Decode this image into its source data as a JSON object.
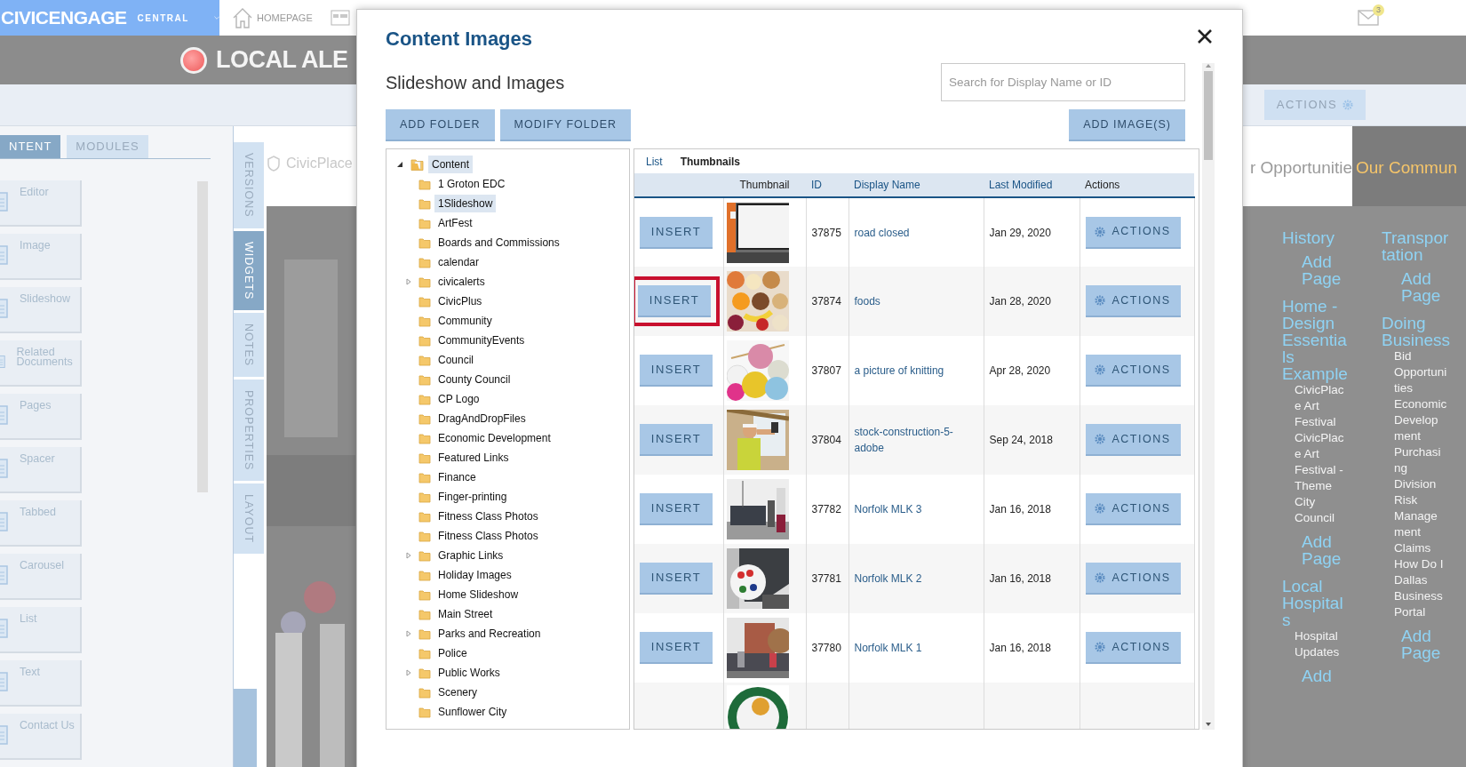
{
  "top_bar": {
    "brand": "CIVICENGAGE",
    "product": "CENTRAL",
    "home_link": "HOMEPAGE",
    "mail_count": "3"
  },
  "alert_banner": {
    "text": "LOCAL ALE"
  },
  "toolbar": {
    "actions_button": "ACTIONS"
  },
  "left_panel": {
    "tabs": [
      {
        "label": "NTENT",
        "selected": true
      },
      {
        "label": "MODULES",
        "selected": false
      }
    ],
    "widgets": [
      {
        "label": "Editor"
      },
      {
        "label": "Image"
      },
      {
        "label": "Slideshow"
      },
      {
        "label": "Related Documents"
      },
      {
        "label": "Pages"
      },
      {
        "label": "Spacer"
      },
      {
        "label": "Tabbed"
      },
      {
        "label": "Carousel"
      },
      {
        "label": "List"
      },
      {
        "label": "Text"
      },
      {
        "label": "Contact Us"
      }
    ]
  },
  "side_tabs": [
    {
      "label": "VERSIONS",
      "selected": false
    },
    {
      "label": "WIDGETS",
      "selected": true
    },
    {
      "label": "NOTES",
      "selected": false
    },
    {
      "label": "PROPERTIES",
      "selected": false
    },
    {
      "label": "LAYOUT",
      "selected": false
    }
  ],
  "page_preview": {
    "logo_text": "CivicPlace",
    "nav_items": [
      {
        "label": "r Opportunitie",
        "selected": false
      },
      {
        "label": "Our Commun",
        "selected": true
      }
    ],
    "menu_columns": [
      {
        "entries": [
          {
            "kind": "heading",
            "text": "History"
          },
          {
            "kind": "add",
            "text": "Add Page"
          },
          {
            "kind": "heading",
            "text": "Home - Design Essentials Example"
          },
          {
            "kind": "link",
            "text": "CivicPlace Art Festival"
          },
          {
            "kind": "link",
            "text": "CivicPlace Art Festival - Theme"
          },
          {
            "kind": "link",
            "text": "City Council"
          },
          {
            "kind": "add",
            "text": "Add Page"
          },
          {
            "kind": "heading",
            "text": "Local Hospitals"
          },
          {
            "kind": "link",
            "text": "Hospital Updates"
          },
          {
            "kind": "add",
            "text": "Add"
          }
        ]
      },
      {
        "entries": [
          {
            "kind": "heading",
            "text": "Transportation"
          },
          {
            "kind": "add",
            "text": "Add Page"
          },
          {
            "kind": "heading",
            "text": "Doing Business"
          },
          {
            "kind": "link",
            "text": "Bid Opportunities"
          },
          {
            "kind": "link",
            "text": "Economic Development"
          },
          {
            "kind": "link",
            "text": "Purchasing Division"
          },
          {
            "kind": "link",
            "text": "Risk Management Claims"
          },
          {
            "kind": "link",
            "text": "How Do I"
          },
          {
            "kind": "link",
            "text": "Dallas Business Portal"
          },
          {
            "kind": "add",
            "text": "Add Page"
          }
        ]
      }
    ]
  },
  "modal": {
    "title": "Content Images",
    "subtitle": "Slideshow and Images",
    "search": {
      "placeholder": "Search for Display Name or ID"
    },
    "buttons": [
      "ADD FOLDER",
      "MODIFY FOLDER"
    ],
    "add_button": "ADD IMAGE(S)",
    "tree": {
      "label": "Content",
      "expanded": true,
      "selected": true,
      "children": [
        {
          "label": "1 Groton EDC",
          "has_children": false,
          "selected": false
        },
        {
          "label": "1Slideshow",
          "has_children": false,
          "selected": true
        },
        {
          "label": "ArtFest",
          "has_children": false,
          "selected": false
        },
        {
          "label": "Boards and Commissions",
          "has_children": false,
          "selected": false
        },
        {
          "label": "calendar",
          "has_children": false,
          "selected": false
        },
        {
          "label": "civicalerts",
          "has_children": true,
          "selected": false
        },
        {
          "label": "CivicPlus",
          "has_children": false,
          "selected": false
        },
        {
          "label": "Community",
          "has_children": false,
          "selected": false
        },
        {
          "label": "CommunityEvents",
          "has_children": false,
          "selected": false
        },
        {
          "label": "Council",
          "has_children": false,
          "selected": false
        },
        {
          "label": "County Council",
          "has_children": false,
          "selected": false
        },
        {
          "label": "CP Logo",
          "has_children": false,
          "selected": false
        },
        {
          "label": "DragAndDropFiles",
          "has_children": false,
          "selected": false
        },
        {
          "label": "Economic Development",
          "has_children": false,
          "selected": false
        },
        {
          "label": "Featured Links",
          "has_children": false,
          "selected": false
        },
        {
          "label": "Finance",
          "has_children": false,
          "selected": false
        },
        {
          "label": "Finger-printing",
          "has_children": false,
          "selected": false
        },
        {
          "label": "Fitness Class Photos",
          "has_children": false,
          "selected": false
        },
        {
          "label": "Fitness Class Photos",
          "has_children": false,
          "selected": false
        },
        {
          "label": "Graphic Links",
          "has_children": true,
          "selected": false
        },
        {
          "label": "Holiday Images",
          "has_children": false,
          "selected": false
        },
        {
          "label": "Home Slideshow",
          "has_children": false,
          "selected": false
        },
        {
          "label": "Main Street",
          "has_children": false,
          "selected": false
        },
        {
          "label": "Parks and Recreation",
          "has_children": true,
          "selected": false
        },
        {
          "label": "Police",
          "has_children": false,
          "selected": false
        },
        {
          "label": "Public Works",
          "has_children": true,
          "selected": false
        },
        {
          "label": "Scenery",
          "has_children": false,
          "selected": false
        },
        {
          "label": "Sunflower City",
          "has_children": false,
          "selected": false
        }
      ]
    },
    "view_tabs": [
      {
        "label": "List",
        "selected": false
      },
      {
        "label": "Thumbnails",
        "selected": true
      }
    ],
    "columns": [
      {
        "label": "Thumbnail",
        "sortable": false
      },
      {
        "label": "ID",
        "sortable": true
      },
      {
        "label": "Display Name",
        "sortable": true
      },
      {
        "label": "Last Modified",
        "sortable": true
      },
      {
        "label": "Actions",
        "sortable": false
      }
    ],
    "rows": [
      {
        "kind": "full",
        "insert": "INSERT",
        "id": "37875",
        "name": "road closed",
        "modified": "Jan 29, 2020",
        "actions": "ACTIONS",
        "highlighted": false
      },
      {
        "kind": "full",
        "insert": "INSERT",
        "id": "37874",
        "name": "foods",
        "modified": "Jan 28, 2020",
        "actions": "ACTIONS",
        "highlighted": true
      },
      {
        "kind": "full",
        "insert": "INSERT",
        "id": "37807",
        "name": "a picture of knitting",
        "modified": "Apr 28, 2020",
        "actions": "ACTIONS",
        "highlighted": false
      },
      {
        "kind": "full",
        "insert": "INSERT",
        "id": "37804",
        "name": "stock-construction-5-adobe",
        "modified": "Sep 24, 2018",
        "actions": "ACTIONS",
        "highlighted": false
      },
      {
        "kind": "full",
        "insert": "INSERT",
        "id": "37782",
        "name": "Norfolk MLK 3",
        "modified": "Jan 16, 2018",
        "actions": "ACTIONS",
        "highlighted": false
      },
      {
        "kind": "full",
        "insert": "INSERT",
        "id": "37781",
        "name": "Norfolk MLK 2",
        "modified": "Jan 16, 2018",
        "actions": "ACTIONS",
        "highlighted": false
      },
      {
        "kind": "full",
        "insert": "INSERT",
        "id": "37780",
        "name": "Norfolk MLK 1",
        "modified": "Jan 16, 2018",
        "actions": "ACTIONS",
        "highlighted": false
      },
      {
        "kind": "cut"
      }
    ]
  }
}
